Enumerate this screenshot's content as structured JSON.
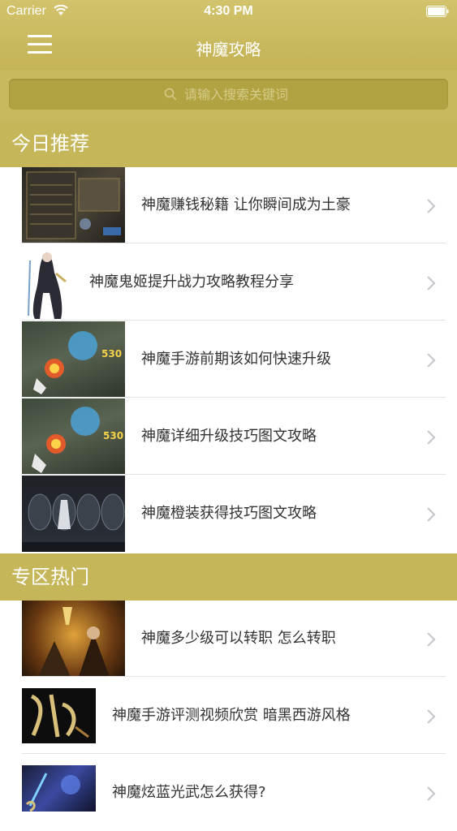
{
  "status_bar": {
    "carrier": "Carrier",
    "time": "4:30 PM"
  },
  "nav": {
    "title": "神魔攻略",
    "menu_icon": "hamburger-menu-icon"
  },
  "search": {
    "placeholder": "请输入搜索关键词"
  },
  "sections": [
    {
      "header": "今日推荐",
      "items": [
        {
          "label": "神魔赚钱秘籍 让你瞬间成为土豪"
        },
        {
          "label": "神魔鬼姬提升战力攻略教程分享"
        },
        {
          "label": "神魔手游前期该如何快速升级"
        },
        {
          "label": "神魔详细升级技巧图文攻略"
        },
        {
          "label": "神魔橙装获得技巧图文攻略"
        }
      ]
    },
    {
      "header": "专区热门",
      "items": [
        {
          "label": "神魔多少级可以转职 怎么转职"
        },
        {
          "label": "神魔手游评测视频欣赏 暗黑西游风格"
        },
        {
          "label": "神魔炫蓝光武怎么获得?"
        }
      ]
    }
  ],
  "colors": {
    "bar": "#c6b65a",
    "search_field": "#b1a341",
    "text": "#333333",
    "separator": "#e2e2e2"
  }
}
